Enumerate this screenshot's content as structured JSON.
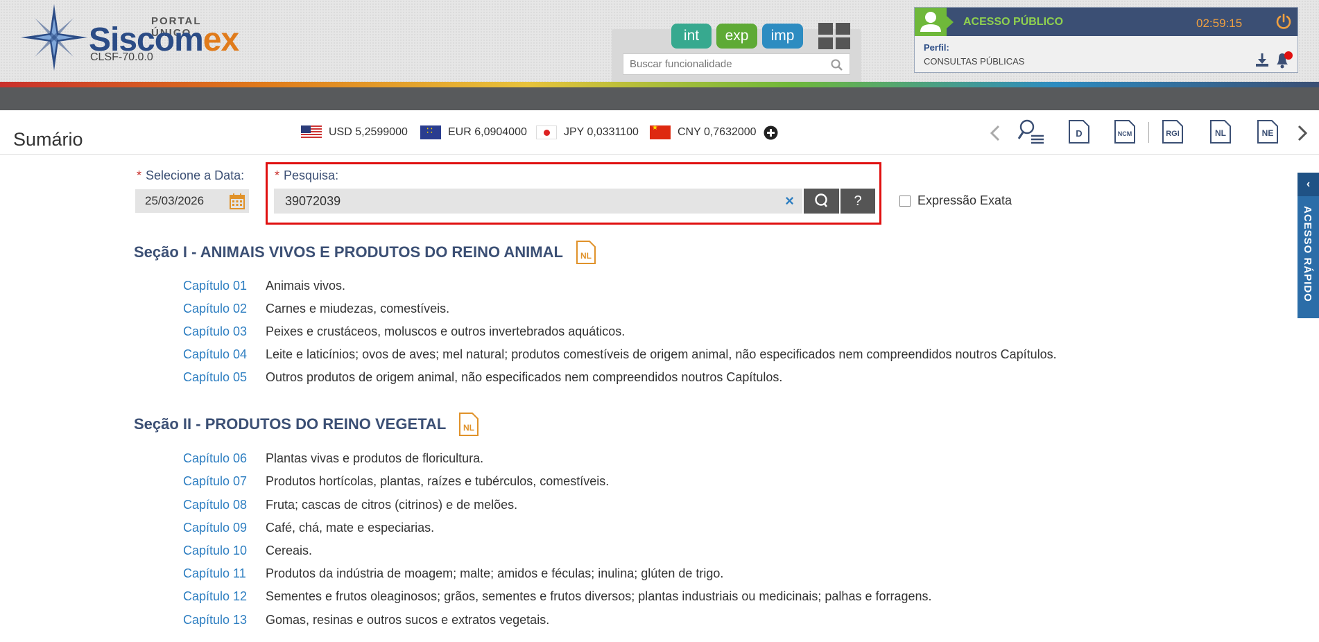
{
  "header": {
    "portal_label": "PORTAL ÚNICO",
    "brand_main": "Siscom",
    "brand_accent": "ex",
    "version": "CLSF-70.0.0",
    "modules": [
      "int",
      "exp",
      "imp"
    ],
    "func_search_placeholder": "Buscar funcionalidade"
  },
  "user": {
    "access_label": "ACESSO PÚBLICO",
    "timer": "02:59:15",
    "perfil_label": "Perfil:",
    "perfil_value": "CONSULTAS PÚBLICAS"
  },
  "toolbar": {
    "title": "Sumário",
    "currencies": [
      {
        "code": "USD 5,2599000"
      },
      {
        "code": "EUR 6,0904000"
      },
      {
        "code": "JPY 0,0331100"
      },
      {
        "code": "CNY 0,7632000"
      }
    ],
    "icon_labels": {
      "d": "D",
      "ncm": "NCM",
      "rgi": "RGI",
      "nl": "NL",
      "ne": "NE"
    }
  },
  "form": {
    "date_label": "Selecione a Data:",
    "date_value": "25/03/2026",
    "search_label": "Pesquisa:",
    "search_value": "39072039",
    "clear": "×",
    "help": "?",
    "exact_label": "Expressão Exata"
  },
  "sections": [
    {
      "title": "Seção I - ANIMAIS VIVOS E PRODUTOS DO REINO ANIMAL",
      "badge": "NL",
      "chapters": [
        {
          "cap": "Capítulo 01",
          "desc": "Animais vivos."
        },
        {
          "cap": "Capítulo 02",
          "desc": "Carnes e miudezas, comestíveis."
        },
        {
          "cap": "Capítulo 03",
          "desc": "Peixes e crustáceos, moluscos e outros invertebrados aquáticos."
        },
        {
          "cap": "Capítulo 04",
          "desc": "Leite e laticínios; ovos de aves; mel natural; produtos comestíveis de origem animal, não especificados nem compreendidos noutros Capítulos."
        },
        {
          "cap": "Capítulo 05",
          "desc": "Outros produtos de origem animal, não especificados nem compreendidos noutros Capítulos."
        }
      ]
    },
    {
      "title": "Seção II - PRODUTOS DO REINO VEGETAL",
      "badge": "NL",
      "chapters": [
        {
          "cap": "Capítulo 06",
          "desc": "Plantas vivas e produtos de floricultura."
        },
        {
          "cap": "Capítulo 07",
          "desc": "Produtos hortícolas, plantas, raízes e tubérculos, comestíveis."
        },
        {
          "cap": "Capítulo 08",
          "desc": "Fruta; cascas de citros (citrinos) e de melões."
        },
        {
          "cap": "Capítulo 09",
          "desc": "Café, chá, mate e especiarias."
        },
        {
          "cap": "Capítulo 10",
          "desc": "Cereais."
        },
        {
          "cap": "Capítulo 11",
          "desc": "Produtos da indústria de moagem; malte; amidos e féculas; inulina; glúten de trigo."
        },
        {
          "cap": "Capítulo 12",
          "desc": "Sementes e frutos oleaginosos; grãos, sementes e frutos diversos; plantas industriais ou medicinais; palhas e forragens."
        },
        {
          "cap": "Capítulo 13",
          "desc": "Gomas, resinas e outros sucos e extratos vegetais."
        }
      ]
    }
  ],
  "side_tab": {
    "label": "ACESSO RÁPIDO"
  },
  "colors": {
    "brand_blue": "#2b4c86",
    "brand_orange": "#e07b1b",
    "link_blue": "#2d7ec1",
    "highlight_red": "#e01010"
  }
}
